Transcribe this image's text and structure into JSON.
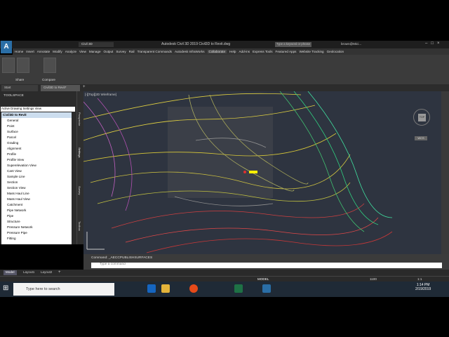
{
  "window": {
    "title": "Autodesk Civil 3D 2019   Civil3D to Revit.dwg",
    "workspace": "Civil 3D",
    "search_placeholder": "Type a keyword or phrase",
    "user": "brown@Mici..."
  },
  "ribbon": {
    "tabs": [
      "Home",
      "Insert",
      "Annotate",
      "Modify",
      "Analyze",
      "View",
      "Manage",
      "Output",
      "Survey",
      "Rail",
      "Transparent Commands",
      "Autodesk InfraWorks",
      "Collaborate",
      "Help",
      "Add-ins",
      "Express Tools",
      "Featured Apps",
      "Website Tracking",
      "Geolocation"
    ],
    "active_tab": "Collaborate",
    "panel_labels": [
      "Share",
      "Compare"
    ]
  },
  "doc_tabs": [
    "Start",
    "Civil3D to Revit*"
  ],
  "toolspace": {
    "title": "TOOLSPACE",
    "view_select": "Active Drawing Settings View",
    "root": "Civil3D to Revit",
    "items": [
      "General",
      "Point",
      "Surface",
      "Parcel",
      "Grading",
      "Alignment",
      "Profile",
      "Profile View",
      "Superelevation View",
      "Cant View",
      "Sample Line",
      "Section",
      "Section View",
      "Mass Haul Line",
      "Mass Haul View",
      "Catchment",
      "Pipe Network",
      "Pipe",
      "Structure",
      "Pressure Network",
      "Pressure Pipe",
      "Fitting"
    ],
    "side_tabs": [
      "Prospector",
      "Settings",
      "Survey",
      "Toolbox"
    ]
  },
  "viewport": {
    "label": "[-][Top][2D Wireframe]",
    "viewcube": "TOP",
    "wcs": "WCS"
  },
  "command": {
    "history": "Command: _AECCPUBLISHSURFACES",
    "prompt": "Type a command"
  },
  "layout_tabs": [
    "Model",
    "Layout1",
    "Layout2"
  ],
  "status": {
    "model": "MODEL",
    "scale": "1:1",
    "value": "1100"
  },
  "taskbar": {
    "search": "Type here to search",
    "time": "1:14 PM",
    "date": "2/19/2019"
  }
}
